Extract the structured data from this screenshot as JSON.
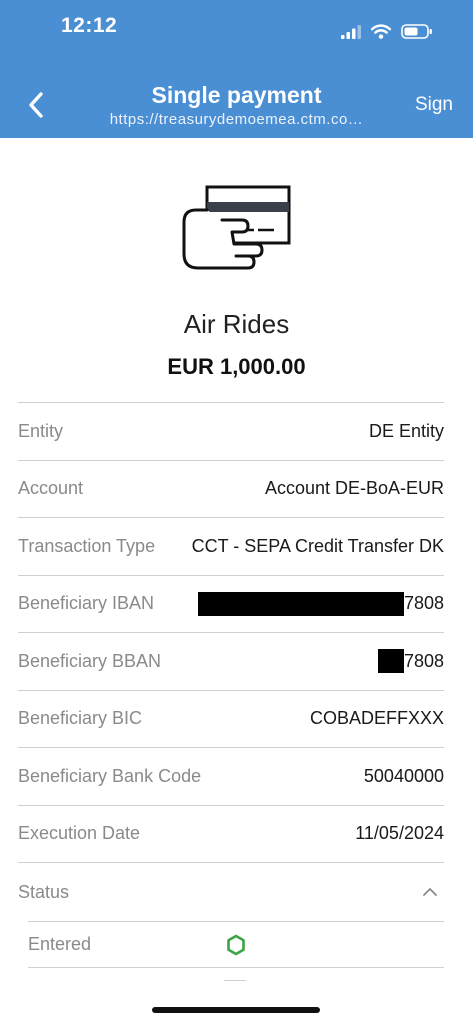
{
  "status_bar": {
    "time": "12:12"
  },
  "nav": {
    "title": "Single payment",
    "url": "https://treasurydemoemea.ctm.co…",
    "sign_label": "Sign"
  },
  "payment": {
    "payee": "Air Rides",
    "amount": "EUR 1,000.00"
  },
  "details": [
    {
      "label": "Entity",
      "value": "DE Entity"
    },
    {
      "label": "Account",
      "value": "Account DE-BoA-EUR"
    },
    {
      "label": "Transaction Type",
      "value": "CCT - SEPA Credit Transfer DK"
    },
    {
      "label": "Beneficiary IBAN",
      "value": "7808"
    },
    {
      "label": "Beneficiary BBAN",
      "value": "7808"
    },
    {
      "label": "Beneficiary BIC",
      "value": "COBADEFFXXX"
    },
    {
      "label": "Beneficiary Bank Code",
      "value": "50040000"
    },
    {
      "label": "Execution Date",
      "value": "11/05/2024"
    }
  ],
  "status": {
    "label": "Status",
    "items": [
      {
        "label": "Entered",
        "indicator_color": "#3aa547"
      }
    ]
  },
  "colors": {
    "header": "#4a8fd4"
  }
}
